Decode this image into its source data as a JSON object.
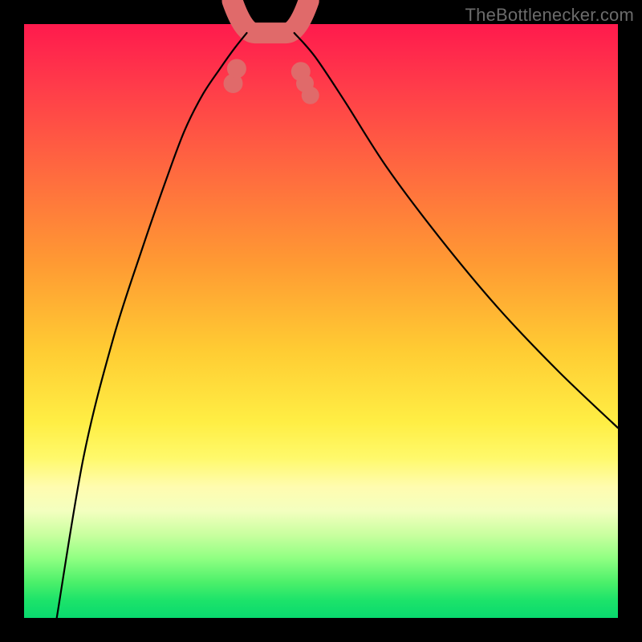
{
  "watermark": "TheBottlenecker.com",
  "chart_data": {
    "type": "line",
    "title": "",
    "xlabel": "",
    "ylabel": "",
    "xlim": [
      0,
      1
    ],
    "ylim": [
      0,
      1
    ],
    "series": [
      {
        "name": "left-curve",
        "x": [
          0.055,
          0.1,
          0.15,
          0.2,
          0.24,
          0.27,
          0.3,
          0.33,
          0.355,
          0.375
        ],
        "y": [
          0.0,
          0.27,
          0.47,
          0.625,
          0.74,
          0.82,
          0.88,
          0.925,
          0.96,
          0.985
        ]
      },
      {
        "name": "right-curve",
        "x": [
          0.455,
          0.49,
          0.54,
          0.61,
          0.7,
          0.8,
          0.9,
          1.0
        ],
        "y": [
          0.985,
          0.945,
          0.87,
          0.76,
          0.64,
          0.52,
          0.415,
          0.32
        ]
      }
    ],
    "highlight_floor": {
      "name": "base-highlight",
      "color": "#e06a6a",
      "x": [
        0.375,
        0.455
      ],
      "y": [
        0.985,
        0.985
      ]
    },
    "dots": [
      {
        "x": 0.352,
        "y": 0.9,
        "r": 12
      },
      {
        "x": 0.358,
        "y": 0.925,
        "r": 12
      },
      {
        "x": 0.466,
        "y": 0.92,
        "r": 12
      },
      {
        "x": 0.473,
        "y": 0.9,
        "r": 11
      },
      {
        "x": 0.482,
        "y": 0.88,
        "r": 11
      }
    ],
    "gradient_stops": [
      {
        "pos": 0.0,
        "color": "#ff1a4d"
      },
      {
        "pos": 0.4,
        "color": "#ff9933"
      },
      {
        "pos": 0.7,
        "color": "#ffee44"
      },
      {
        "pos": 1.0,
        "color": "#09d96e"
      }
    ]
  }
}
